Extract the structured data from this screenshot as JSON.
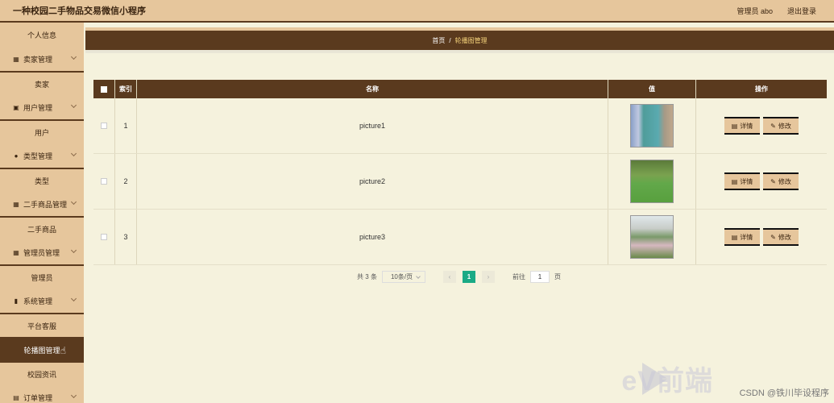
{
  "app": {
    "title": "一种校园二手物品交易微信小程序"
  },
  "header": {
    "user_label": "管理员 abo",
    "logout": "退出登录"
  },
  "sidebar": {
    "items": [
      {
        "kind": "sub",
        "label": "个人信息"
      },
      {
        "kind": "group",
        "label": "卖家管理",
        "icon": "grid-icon",
        "glyph": "▦"
      },
      {
        "kind": "sub",
        "label": "卖家"
      },
      {
        "kind": "group",
        "label": "用户管理",
        "icon": "card-icon",
        "glyph": "▣"
      },
      {
        "kind": "sub",
        "label": "用户"
      },
      {
        "kind": "group",
        "label": "类型管理",
        "icon": "user-icon",
        "glyph": "●"
      },
      {
        "kind": "sub",
        "label": "类型"
      },
      {
        "kind": "group",
        "label": "二手商品管理",
        "icon": "grid-icon",
        "glyph": "▦"
      },
      {
        "kind": "sub",
        "label": "二手商品"
      },
      {
        "kind": "group",
        "label": "管理员管理",
        "icon": "grid-icon",
        "glyph": "▦"
      },
      {
        "kind": "sub",
        "label": "管理员"
      },
      {
        "kind": "group",
        "label": "系统管理",
        "icon": "bar-chart-icon",
        "glyph": "▮"
      },
      {
        "kind": "sub",
        "label": "平台客服"
      },
      {
        "kind": "active",
        "label": "轮播图管理"
      },
      {
        "kind": "sub",
        "label": "校园资讯"
      },
      {
        "kind": "group",
        "label": "订单管理",
        "icon": "clipboard-icon",
        "glyph": "▤"
      }
    ]
  },
  "breadcrumb": {
    "home": "首页",
    "separator": "/",
    "current": "轮播图管理"
  },
  "table": {
    "headers": {
      "index": "索引",
      "name": "名称",
      "value": "值",
      "actions": "操作"
    },
    "rows": [
      {
        "index": "1",
        "name": "picture1",
        "thumb": "thumb1"
      },
      {
        "index": "2",
        "name": "picture2",
        "thumb": "thumb2"
      },
      {
        "index": "3",
        "name": "picture3",
        "thumb": "thumb3"
      }
    ],
    "detail_label": "详情",
    "edit_label": "修改"
  },
  "pagination": {
    "total": "共 3 条",
    "page_size": "10条/页",
    "current_page": "1",
    "goto_label": "前往",
    "goto_value": "1",
    "page_unit": "页"
  },
  "overlay": {
    "watermark": "eV前端",
    "credit": "CSDN @铁川毕设程序"
  },
  "colors": {
    "header_bg": "#e6c69c",
    "dark_brown": "#5a3a1e",
    "content_bg": "#f5f2dd",
    "page_active": "#1aaa85"
  }
}
